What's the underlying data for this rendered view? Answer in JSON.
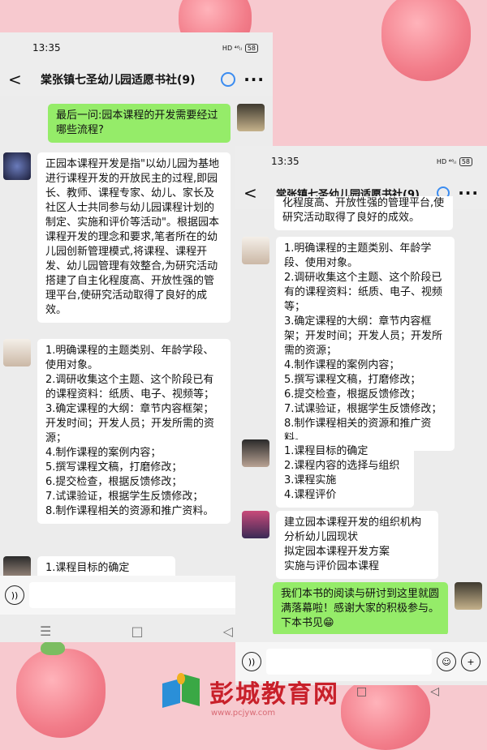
{
  "colors": {
    "bg": "#f7c9cf",
    "bubble_green": "#95ec69",
    "bubble_white": "#ffffff"
  },
  "phone_left": {
    "status": {
      "time": "13:35",
      "icons": "HD ⁴⁶ᵢₗ",
      "battery": "58"
    },
    "header": {
      "back": "<",
      "title": "棠张镇七圣幼儿园适愿书社(9)",
      "more": "···"
    },
    "messages": [
      {
        "side": "right",
        "text": "最后一问:园本课程的开发需要经过哪些流程?"
      },
      {
        "side": "left",
        "text": "正园本课程开发是指\"以幼儿园为基地进行课程开发的开放民主的过程,即园长、教师、课程专家、幼儿、家长及社区人士共同参与幼儿园课程计划的制定、实施和评价等活动\"。根据园本课程开发的理念和要求,笔者所在的幼儿园创新管理模式,将课程、课程开发、幼儿园管理有效整合,为研究活动搭建了自主化程度高、开放性强的管理平台,使研究活动取得了良好的成效。"
      },
      {
        "side": "left",
        "text": "1.明确课程的主题类别、年龄学段、使用对象。\n2.调研收集这个主题、这个阶段已有的课程资料：纸质、电子、视频等；\n3.确定课程的大纲：章节内容框架；开发时间；开发人员；开发所需的资源；\n4.制作课程的案例内容；\n5.撰写课程文稿，打磨修改；\n6.提交检查，根据反馈修改；\n7.试课验证，根据学生反馈修改；\n8.制作课程相关的资源和推广资料。"
      },
      {
        "side": "left",
        "text": "1.课程目标的确定"
      }
    ],
    "nav": [
      "☰",
      "□",
      "◁"
    ]
  },
  "phone_right": {
    "status": {
      "time": "13:35",
      "icons": "HD ⁴⁶ᵢₗ",
      "battery": "58"
    },
    "header": {
      "back": "<",
      "title": "棠张镇七圣幼儿园适愿书社(9)",
      "more": "···"
    },
    "messages": [
      {
        "side": "left",
        "text": "化程度高、开放性强的管理平台,使研究活动取得了良好的成效。"
      },
      {
        "side": "left",
        "text": "1.明确课程的主题类别、年龄学段、使用对象。\n2.调研收集这个主题、这个阶段已有的课程资料：纸质、电子、视频等；\n3.确定课程的大纲：章节内容框架；开发时间；开发人员；开发所需的资源；\n4.制作课程的案例内容；\n5.撰写课程文稿，打磨修改；\n6.提交检查，根据反馈修改；\n7.试课验证，根据学生反馈修改；\n8.制作课程相关的资源和推广资料。"
      },
      {
        "side": "left",
        "text": "1.课程目标的确定\n2.课程内容的选择与组织\n3.课程实施\n4.课程评价"
      },
      {
        "side": "left",
        "text": "建立园本课程开发的组织机构\n分析幼儿园现状\n拟定园本课程开发方案\n实施与评价园本课程"
      },
      {
        "side": "right",
        "text": "我们本书的阅读与研讨到这里就圆满落幕啦！感谢大家的积极参与。下本书见😁"
      }
    ],
    "nav": [
      "□",
      "◁"
    ]
  },
  "watermark": {
    "name": "彭城教育网",
    "url": "www.pcjyw.com"
  }
}
